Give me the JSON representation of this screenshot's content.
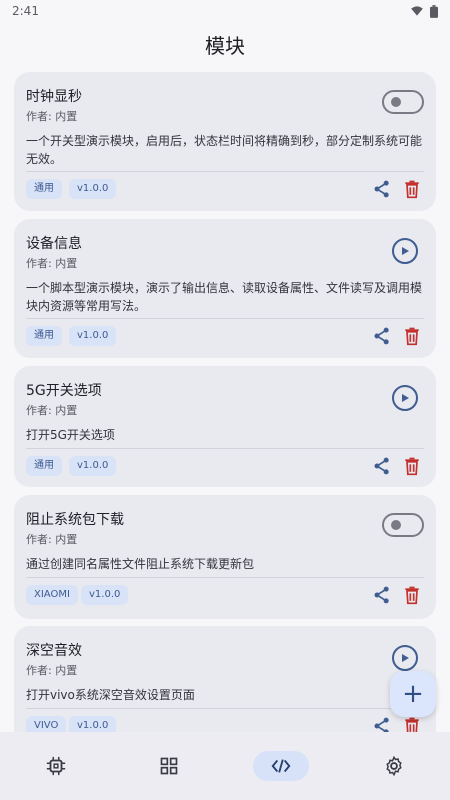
{
  "status": {
    "time": "2:41"
  },
  "header": {
    "title": "模块"
  },
  "modules": [
    {
      "title": "时钟显秒",
      "author": "作者: 内置",
      "description": "一个开关型演示模块，启用后，状态栏时间将精确到秒，部分定制系统可能无效。",
      "tags": [
        "通用",
        "v1.0.0"
      ],
      "control": "toggle"
    },
    {
      "title": "设备信息",
      "author": "作者: 内置",
      "description": "一个脚本型演示模块，演示了输出信息、读取设备属性、文件读写及调用模块内资源等常用写法。",
      "tags": [
        "通用",
        "v1.0.0"
      ],
      "control": "play"
    },
    {
      "title": "5G开关选项",
      "author": "作者: 内置",
      "description": "打开5G开关选项",
      "tags": [
        "通用",
        "v1.0.0"
      ],
      "control": "play"
    },
    {
      "title": "阻止系统包下载",
      "author": "作者: 内置",
      "description": "通过创建同名属性文件阻止系统下载更新包",
      "tags": [
        "XIAOMI",
        "v1.0.0"
      ],
      "control": "toggle"
    },
    {
      "title": "深空音效",
      "author": "作者: 内置",
      "description": "打开vivo系统深空音效设置页面",
      "tags": [
        "VIVO",
        "v1.0.0"
      ],
      "control": "play"
    }
  ],
  "fab": {
    "label": "+"
  },
  "nav": {
    "items": [
      {
        "icon": "chip-icon"
      },
      {
        "icon": "grid-icon"
      },
      {
        "icon": "code-icon",
        "active": true
      },
      {
        "icon": "gear-icon"
      }
    ]
  }
}
